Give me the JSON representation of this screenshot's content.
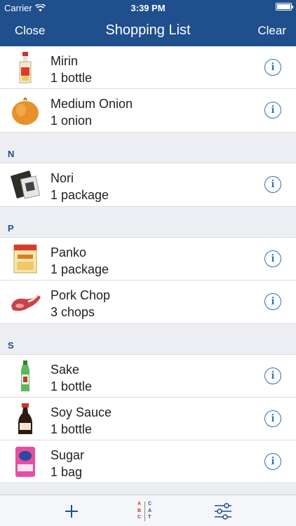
{
  "status_bar": {
    "carrier": "Carrier",
    "time": "3:39 PM"
  },
  "nav": {
    "close_label": "Close",
    "title": "Shopping List",
    "clear_label": "Clear"
  },
  "list": {
    "items_m": [
      {
        "name": "Mirin",
        "quantity": "1 bottle",
        "icon": "mirin-bottle-icon"
      },
      {
        "name": "Medium Onion",
        "quantity": "1 onion",
        "icon": "onion-icon"
      }
    ],
    "section_n": {
      "letter": "N"
    },
    "items_n": [
      {
        "name": "Nori",
        "quantity": "1 package",
        "icon": "nori-package-icon"
      }
    ],
    "section_p": {
      "letter": "P"
    },
    "items_p": [
      {
        "name": "Panko",
        "quantity": "1 package",
        "icon": "panko-package-icon"
      },
      {
        "name": "Pork Chop",
        "quantity": "3 chops",
        "icon": "pork-chop-icon"
      }
    ],
    "section_s": {
      "letter": "S"
    },
    "items_s": [
      {
        "name": "Sake",
        "quantity": "1 bottle",
        "icon": "sake-bottle-icon"
      },
      {
        "name": "Soy Sauce",
        "quantity": "1 bottle",
        "icon": "soy-sauce-bottle-icon"
      },
      {
        "name": "Sugar",
        "quantity": "1 bag",
        "icon": "sugar-bag-icon"
      }
    ]
  },
  "toolbar": {
    "sort_letters_left": [
      "A",
      "B",
      "C"
    ],
    "sort_letters_right": [
      "C",
      "A",
      "T"
    ]
  },
  "colors": {
    "nav_bg": "#1f4f8c",
    "accent": "#2f6ec4",
    "section_bg": "#eceef3"
  }
}
